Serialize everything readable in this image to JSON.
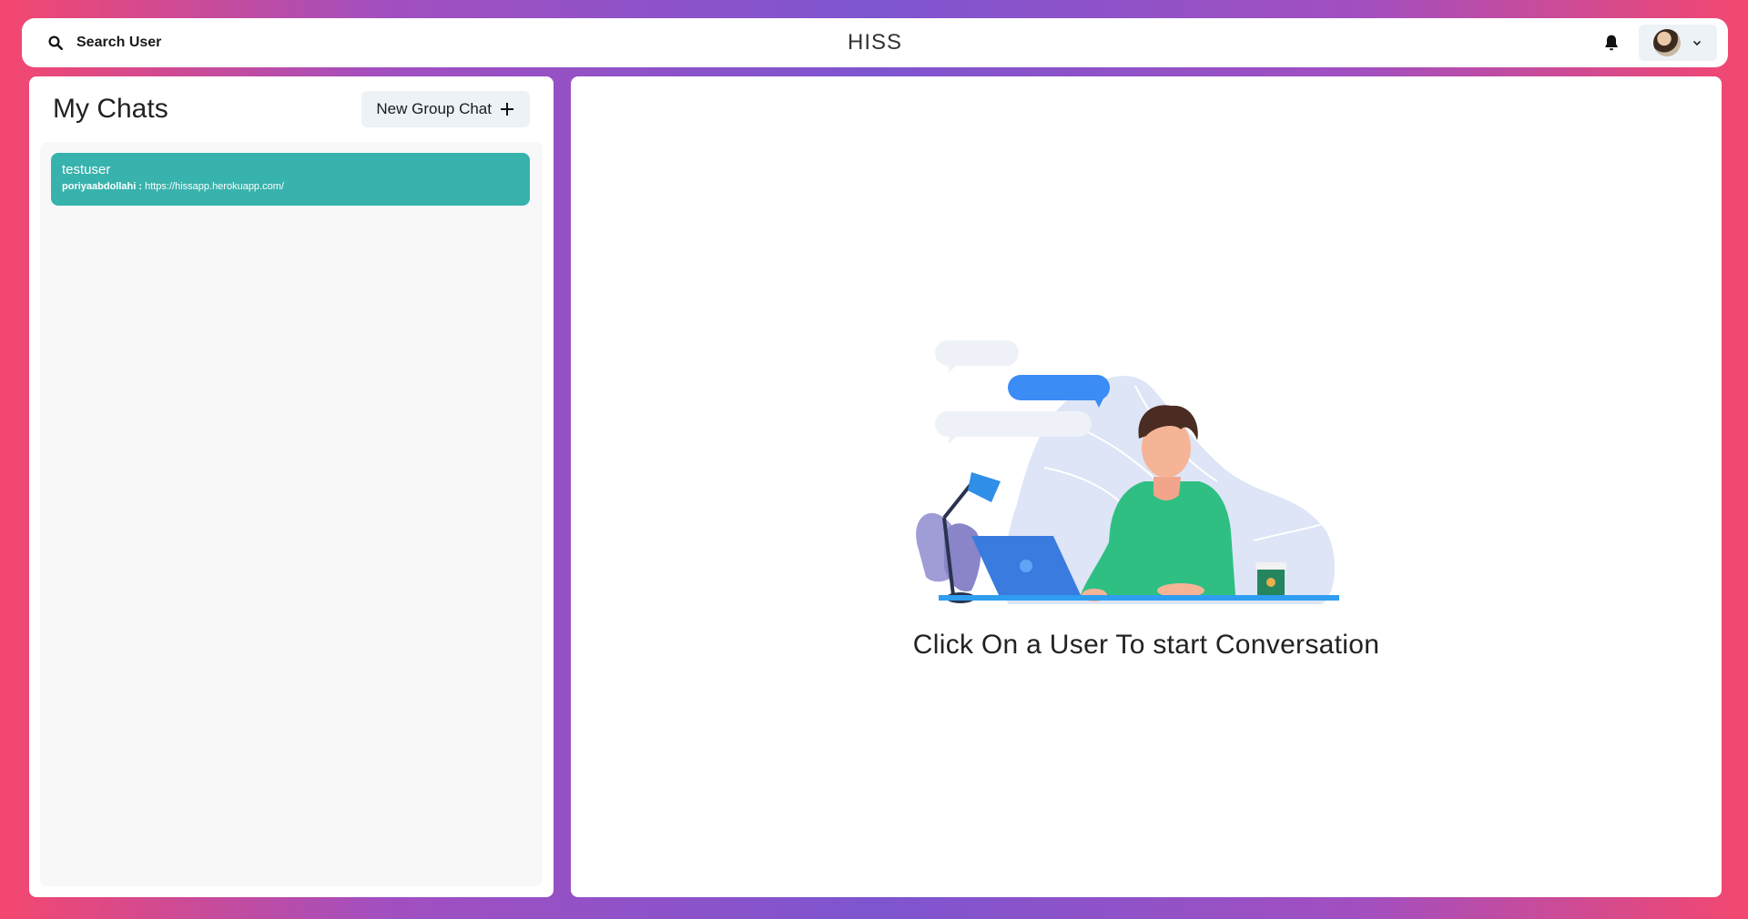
{
  "header": {
    "search_label": "Search User",
    "app_title": "HISS"
  },
  "sidebar": {
    "title": "My Chats",
    "new_group_label": "New Group Chat",
    "chats": [
      {
        "name": "testuser",
        "last_sender": "poriyaabdollahi :",
        "last_message": "https://hissapp.herokuapp.com/"
      }
    ]
  },
  "main": {
    "empty_text": "Click On a User To start Conversation"
  },
  "colors": {
    "accent_teal": "#38b2ac",
    "button_bg": "#edf2f7",
    "gradient_pink": "#f4476f",
    "gradient_purple": "#7e55cf"
  }
}
